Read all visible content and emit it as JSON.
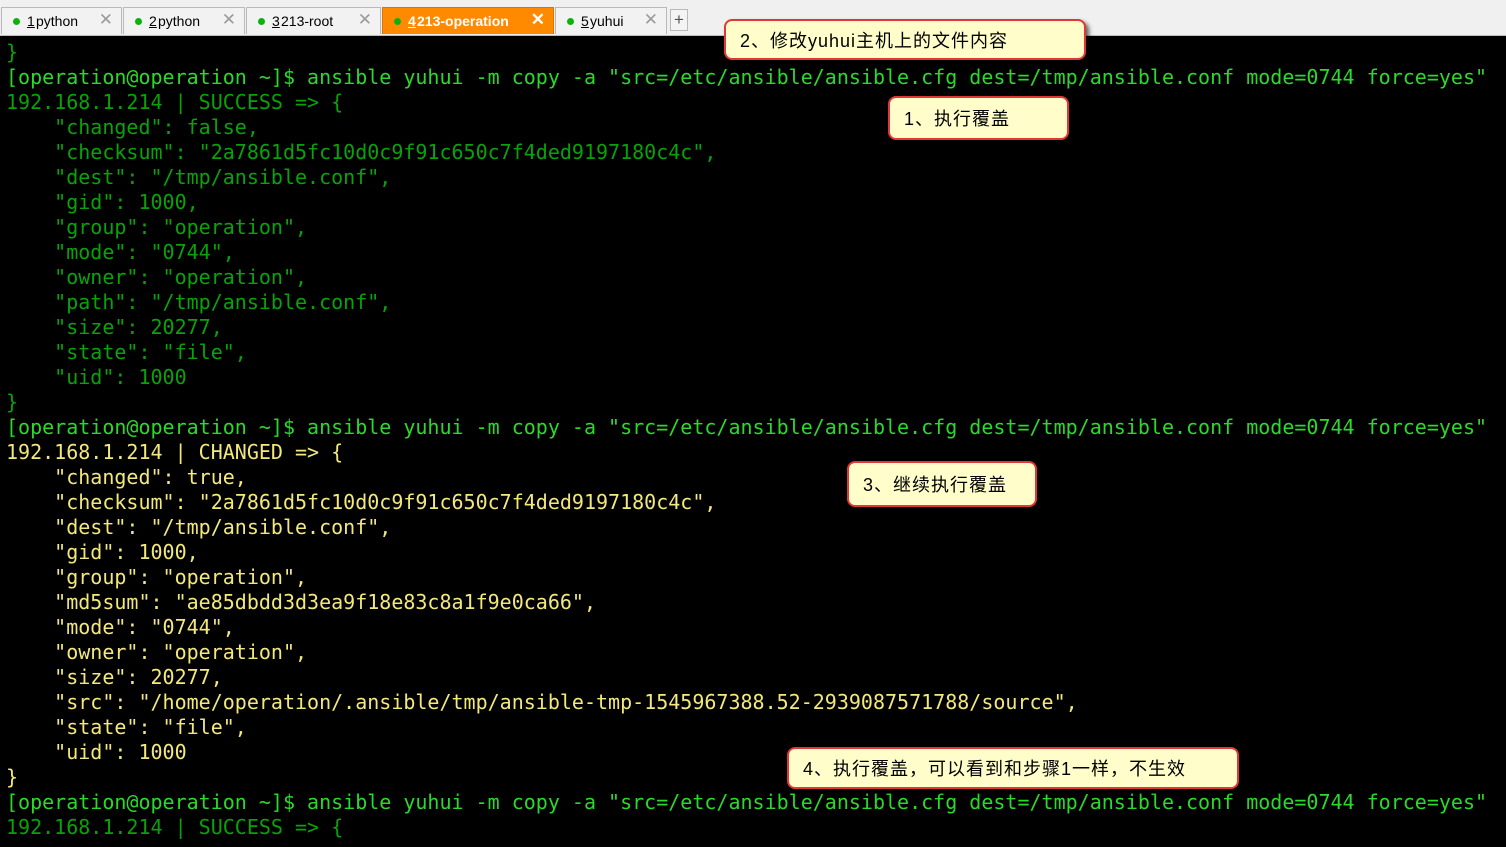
{
  "tabs": [
    {
      "num": "1",
      "name": " python",
      "active": false
    },
    {
      "num": "2",
      "name": " python",
      "active": false
    },
    {
      "num": "3",
      "name": " 213-root",
      "active": false
    },
    {
      "num": "4",
      "name": " 213-operation",
      "active": true
    },
    {
      "num": "5",
      "name": " yuhui",
      "active": false
    }
  ],
  "tab_close_glyph": "✕",
  "tab_add_glyph": "+",
  "terminal": {
    "lines": [
      {
        "text": "}",
        "color": "dim"
      },
      {
        "text": "[operation@operation ~]$ ansible yuhui -m copy -a \"src=/etc/ansible/ansible.cfg dest=/tmp/ansible.conf mode=0744 force=yes\"",
        "color": "green"
      },
      {
        "text": "192.168.1.214 | SUCCESS => {",
        "color": "dim"
      },
      {
        "text": "    \"changed\": false,",
        "color": "dim"
      },
      {
        "text": "    \"checksum\": \"2a7861d5fc10d0c9f91c650c7f4ded9197180c4c\",",
        "color": "dim"
      },
      {
        "text": "    \"dest\": \"/tmp/ansible.conf\",",
        "color": "dim"
      },
      {
        "text": "    \"gid\": 1000,",
        "color": "dim"
      },
      {
        "text": "    \"group\": \"operation\",",
        "color": "dim"
      },
      {
        "text": "    \"mode\": \"0744\",",
        "color": "dim"
      },
      {
        "text": "    \"owner\": \"operation\",",
        "color": "dim"
      },
      {
        "text": "    \"path\": \"/tmp/ansible.conf\",",
        "color": "dim"
      },
      {
        "text": "    \"size\": 20277,",
        "color": "dim"
      },
      {
        "text": "    \"state\": \"file\",",
        "color": "dim"
      },
      {
        "text": "    \"uid\": 1000",
        "color": "dim"
      },
      {
        "text": "}",
        "color": "dim"
      },
      {
        "text": "[operation@operation ~]$ ansible yuhui -m copy -a \"src=/etc/ansible/ansible.cfg dest=/tmp/ansible.conf mode=0744 force=yes\"",
        "color": "green"
      },
      {
        "text": "192.168.1.214 | CHANGED => {",
        "color": "yellow"
      },
      {
        "text": "    \"changed\": true,",
        "color": "yellow"
      },
      {
        "text": "    \"checksum\": \"2a7861d5fc10d0c9f91c650c7f4ded9197180c4c\",",
        "color": "yellow"
      },
      {
        "text": "    \"dest\": \"/tmp/ansible.conf\",",
        "color": "yellow"
      },
      {
        "text": "    \"gid\": 1000,",
        "color": "yellow"
      },
      {
        "text": "    \"group\": \"operation\",",
        "color": "yellow"
      },
      {
        "text": "    \"md5sum\": \"ae85dbdd3d3ea9f18e83c8a1f9e0ca66\",",
        "color": "yellow"
      },
      {
        "text": "    \"mode\": \"0744\",",
        "color": "yellow"
      },
      {
        "text": "    \"owner\": \"operation\",",
        "color": "yellow"
      },
      {
        "text": "    \"size\": 20277,",
        "color": "yellow"
      },
      {
        "text": "    \"src\": \"/home/operation/.ansible/tmp/ansible-tmp-1545967388.52-2939087571788/source\",",
        "color": "yellow"
      },
      {
        "text": "    \"state\": \"file\",",
        "color": "yellow"
      },
      {
        "text": "    \"uid\": 1000",
        "color": "yellow"
      },
      {
        "text": "}",
        "color": "yellow"
      },
      {
        "text": "[operation@operation ~]$ ansible yuhui -m copy -a \"src=/etc/ansible/ansible.cfg dest=/tmp/ansible.conf mode=0744 force=yes\"",
        "color": "green"
      },
      {
        "text": "192.168.1.214 | SUCCESS => {",
        "color": "dim"
      }
    ]
  },
  "callouts": {
    "c1": "1、执行覆盖",
    "c2": "2、修改yuhui主机上的文件内容",
    "c3": "3、继续执行覆盖",
    "c4": "4、执行覆盖，可以看到和步骤1一样，不生效"
  },
  "colors": {
    "prompt_green": "#2bd92b",
    "ok_dim_green": "#08a308",
    "changed_yellow": "#f3e87c",
    "active_tab_orange": "#ff8a00",
    "callout_border": "#e33636",
    "callout_fill": "#fffecb"
  }
}
